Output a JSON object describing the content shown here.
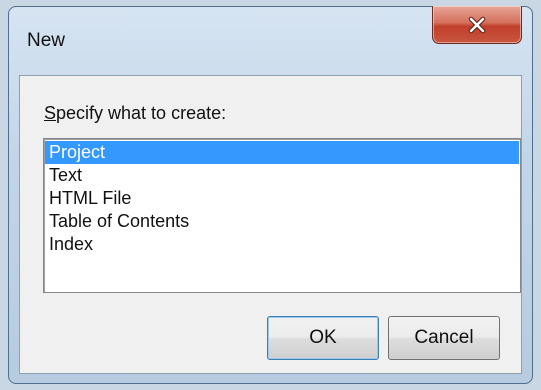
{
  "window": {
    "title": "New",
    "close_icon": "close-x-icon"
  },
  "dialog": {
    "prompt_accel": "S",
    "prompt_rest": "pecify what to create:",
    "items": [
      "Project",
      "Text",
      "HTML File",
      "Table of Contents",
      "Index"
    ],
    "selected_index": 0
  },
  "buttons": {
    "ok_label": "OK",
    "cancel_label": "Cancel"
  },
  "colors": {
    "selection": "#3399ff",
    "close_button": "#c9553f"
  }
}
